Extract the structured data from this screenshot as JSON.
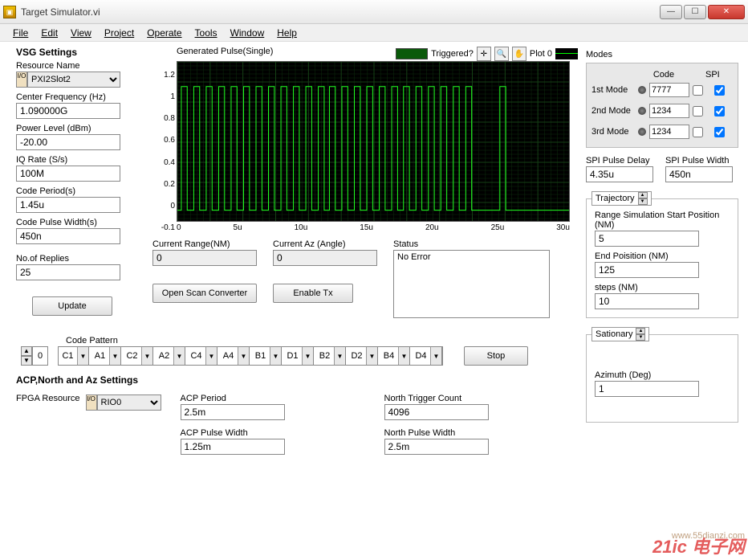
{
  "window": {
    "title": "Target Simulator.vi"
  },
  "menu": [
    "File",
    "Edit",
    "View",
    "Project",
    "Operate",
    "Tools",
    "Window",
    "Help"
  ],
  "vsg": {
    "title": "VSG Settings",
    "resource_name_label": "Resource Name",
    "resource_name": "PXI2Slot2",
    "center_freq_label": "Center Frequency (Hz)",
    "center_freq": "1.090000G",
    "power_label": "Power Level (dBm)",
    "power": "-20.00",
    "iq_label": "IQ Rate (S/s)",
    "iq": "100M",
    "code_period_label": "Code Period(s)",
    "code_period": "1.45u",
    "code_pw_label": "Code Pulse Width(s)",
    "code_pw": "450n",
    "replies_label": "No.of Replies",
    "replies": "25",
    "update_btn": "Update"
  },
  "chart": {
    "title": "Generated Pulse(Single)",
    "triggered_label": "Triggered?",
    "plot_label": "Plot 0"
  },
  "chart_data": {
    "type": "line",
    "title": "Generated Pulse(Single)",
    "xlabel": "",
    "ylabel": "",
    "xlim": [
      0,
      30
    ],
    "ylim": [
      -0.1,
      1.2
    ],
    "x_unit": "u",
    "y_low": 0,
    "y_high": 1,
    "pairs": [
      {
        "start": 0.3,
        "end": 0.75,
        "gap": 0.5
      },
      {
        "start": 2.2,
        "end": 2.65,
        "gap": 0.5
      },
      {
        "start": 4.1,
        "end": 4.55,
        "gap": 0.5
      },
      {
        "start": 6.0,
        "end": 6.45,
        "gap": 0.5
      },
      {
        "start": 7.9,
        "end": 8.35,
        "gap": 0.5
      },
      {
        "start": 9.8,
        "end": 10.25,
        "gap": 0.5
      },
      {
        "start": 11.6,
        "end": 12.05,
        "gap": 0.5
      },
      {
        "start": 13.5,
        "end": 13.95,
        "gap": 0.5
      },
      {
        "start": 15.4,
        "end": 15.85,
        "gap": 0.5
      },
      {
        "start": 17.25,
        "end": 17.7,
        "gap": 0.5
      },
      {
        "start": 19.15,
        "end": 19.6,
        "gap": 0.5
      },
      {
        "start": 21.05,
        "end": 21.5,
        "gap": 0.5
      },
      {
        "start": 24.6,
        "end": 25.05,
        "gap": 0.0
      }
    ],
    "x_ticks": [
      0,
      5,
      10,
      15,
      20,
      25,
      30
    ],
    "y_ticks": [
      1.2,
      1,
      0.8,
      0.6,
      0.4,
      0.2,
      0,
      -0.1
    ]
  },
  "mid": {
    "range_label": "Current Range(NM)",
    "range": "0",
    "az_label": "Current Az (Angle)",
    "az": "0",
    "status_label": "Status",
    "status": "No Error",
    "scan_btn": "Open Scan Converter",
    "enable_btn": "Enable Tx"
  },
  "code_pattern": {
    "label": "Code Pattern",
    "index": "0",
    "items": [
      "C1",
      "A1",
      "C2",
      "A2",
      "C4",
      "A4",
      "B1",
      "D1",
      "B2",
      "D2",
      "B4",
      "D4"
    ],
    "stop_btn": "Stop"
  },
  "acp": {
    "title": "ACP,North and Az Settings",
    "fpga_label": "FPGA Resource",
    "fpga": "RIO0",
    "period_label": "ACP Period",
    "period": "2.5m",
    "pw_label": "ACP Pulse Width",
    "pw": "1.25m",
    "ntc_label": "North Trigger Count",
    "ntc": "4096",
    "npw_label": "North Pulse Width",
    "npw": "2.5m"
  },
  "modes": {
    "title": "Modes",
    "code_hdr": "Code",
    "spi_hdr": "SPI",
    "rows": [
      {
        "label": "1st Mode",
        "code": "7777",
        "chk": false,
        "spi": true
      },
      {
        "label": "2nd Mode",
        "code": "1234",
        "chk": false,
        "spi": true
      },
      {
        "label": "3rd Mode",
        "code": "1234",
        "chk": false,
        "spi": true
      }
    ],
    "delay_label": "SPI Pulse Delay",
    "delay": "4.35u",
    "width_label": "SPI Pulse Width",
    "width": "450n"
  },
  "trajectory": {
    "title": "Trajectory",
    "start_label": "Range Simulation Start Position (NM)",
    "start": "5",
    "end_label": "End Poisition (NM)",
    "end": "125",
    "steps_label": "steps (NM)",
    "steps": "10"
  },
  "stationary": {
    "title": "Sationary",
    "az_label": "Azimuth (Deg)",
    "az": "1"
  },
  "watermark": {
    "a": "21ic 电子网",
    "b": "www.55dianzi.com"
  }
}
